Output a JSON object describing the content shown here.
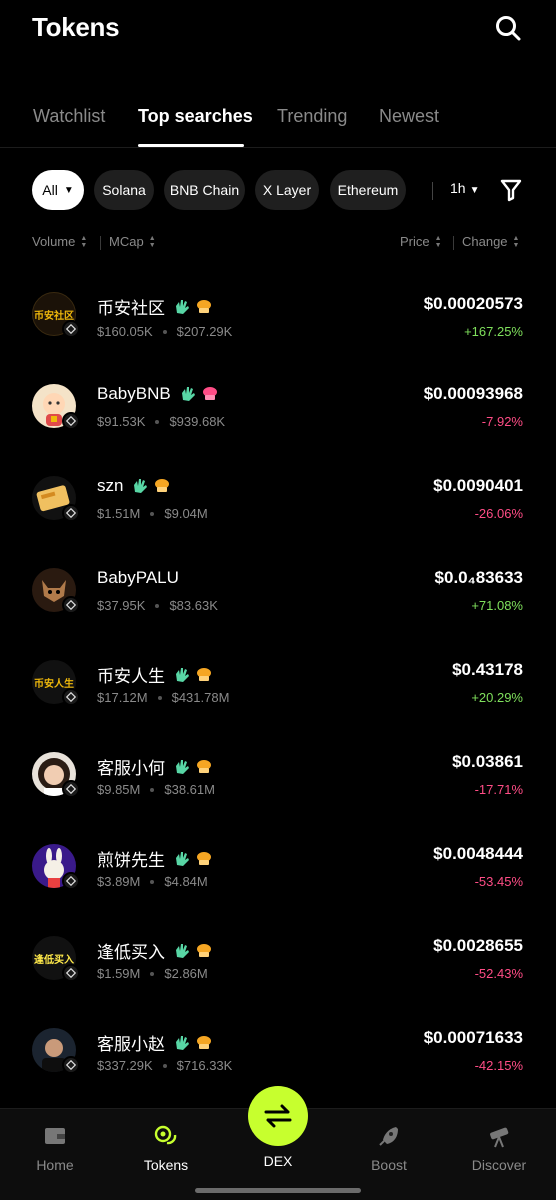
{
  "header": {
    "title": "Tokens"
  },
  "tabs": [
    {
      "label": "Watchlist"
    },
    {
      "label": "Top searches"
    },
    {
      "label": "Trending"
    },
    {
      "label": "Newest"
    }
  ],
  "chips": [
    {
      "label": "All"
    },
    {
      "label": "Solana"
    },
    {
      "label": "BNB Chain"
    },
    {
      "label": "X Layer"
    },
    {
      "label": "Ethereum"
    }
  ],
  "time_filter": {
    "value": "1h"
  },
  "sort": {
    "volume": "Volume",
    "mcap": "MCap",
    "price": "Price",
    "change": "Change"
  },
  "tokens": [
    {
      "name": "币安社区",
      "avatar_text": "币安社区",
      "volume": "$160.05K",
      "mcap": "$207.29K",
      "price": "$0.00020573",
      "change": "+167.25%",
      "direction": "up"
    },
    {
      "name": "BabyBNB",
      "avatar_text": "",
      "volume": "$91.53K",
      "mcap": "$939.68K",
      "price": "$0.00093968",
      "change": "-7.92%",
      "direction": "down"
    },
    {
      "name": "szn",
      "avatar_text": "",
      "volume": "$1.51M",
      "mcap": "$9.04M",
      "price": "$0.0090401",
      "change": "-26.06%",
      "direction": "down"
    },
    {
      "name": "BabyPALU",
      "avatar_text": "",
      "volume": "$37.95K",
      "mcap": "$83.63K",
      "price": "$0.0₄83633",
      "change": "+71.08%",
      "direction": "up"
    },
    {
      "name": "币安人生",
      "avatar_text": "币安人生",
      "volume": "$17.12M",
      "mcap": "$431.78M",
      "price": "$0.43178",
      "change": "+20.29%",
      "direction": "up"
    },
    {
      "name": "客服小何",
      "avatar_text": "",
      "volume": "$9.85M",
      "mcap": "$38.61M",
      "price": "$0.03861",
      "change": "-17.71%",
      "direction": "down"
    },
    {
      "name": "煎饼先生",
      "avatar_text": "",
      "volume": "$3.89M",
      "mcap": "$4.84M",
      "price": "$0.0048444",
      "change": "-53.45%",
      "direction": "down"
    },
    {
      "name": "逢低买入",
      "avatar_text": "逢低买入",
      "volume": "$1.59M",
      "mcap": "$2.86M",
      "price": "$0.0028655",
      "change": "-52.43%",
      "direction": "down"
    },
    {
      "name": "客服小赵",
      "avatar_text": "",
      "volume": "$337.29K",
      "mcap": "$716.33K",
      "price": "$0.00071633",
      "change": "-42.15%",
      "direction": "down"
    }
  ],
  "nav": {
    "home": "Home",
    "tokens": "Tokens",
    "dex": "DEX",
    "boost": "Boost",
    "discover": "Discover"
  },
  "colors": {
    "accent": "#c7ff2e",
    "up": "#7fe05c",
    "down": "#ff4d86",
    "background": "#000000"
  }
}
